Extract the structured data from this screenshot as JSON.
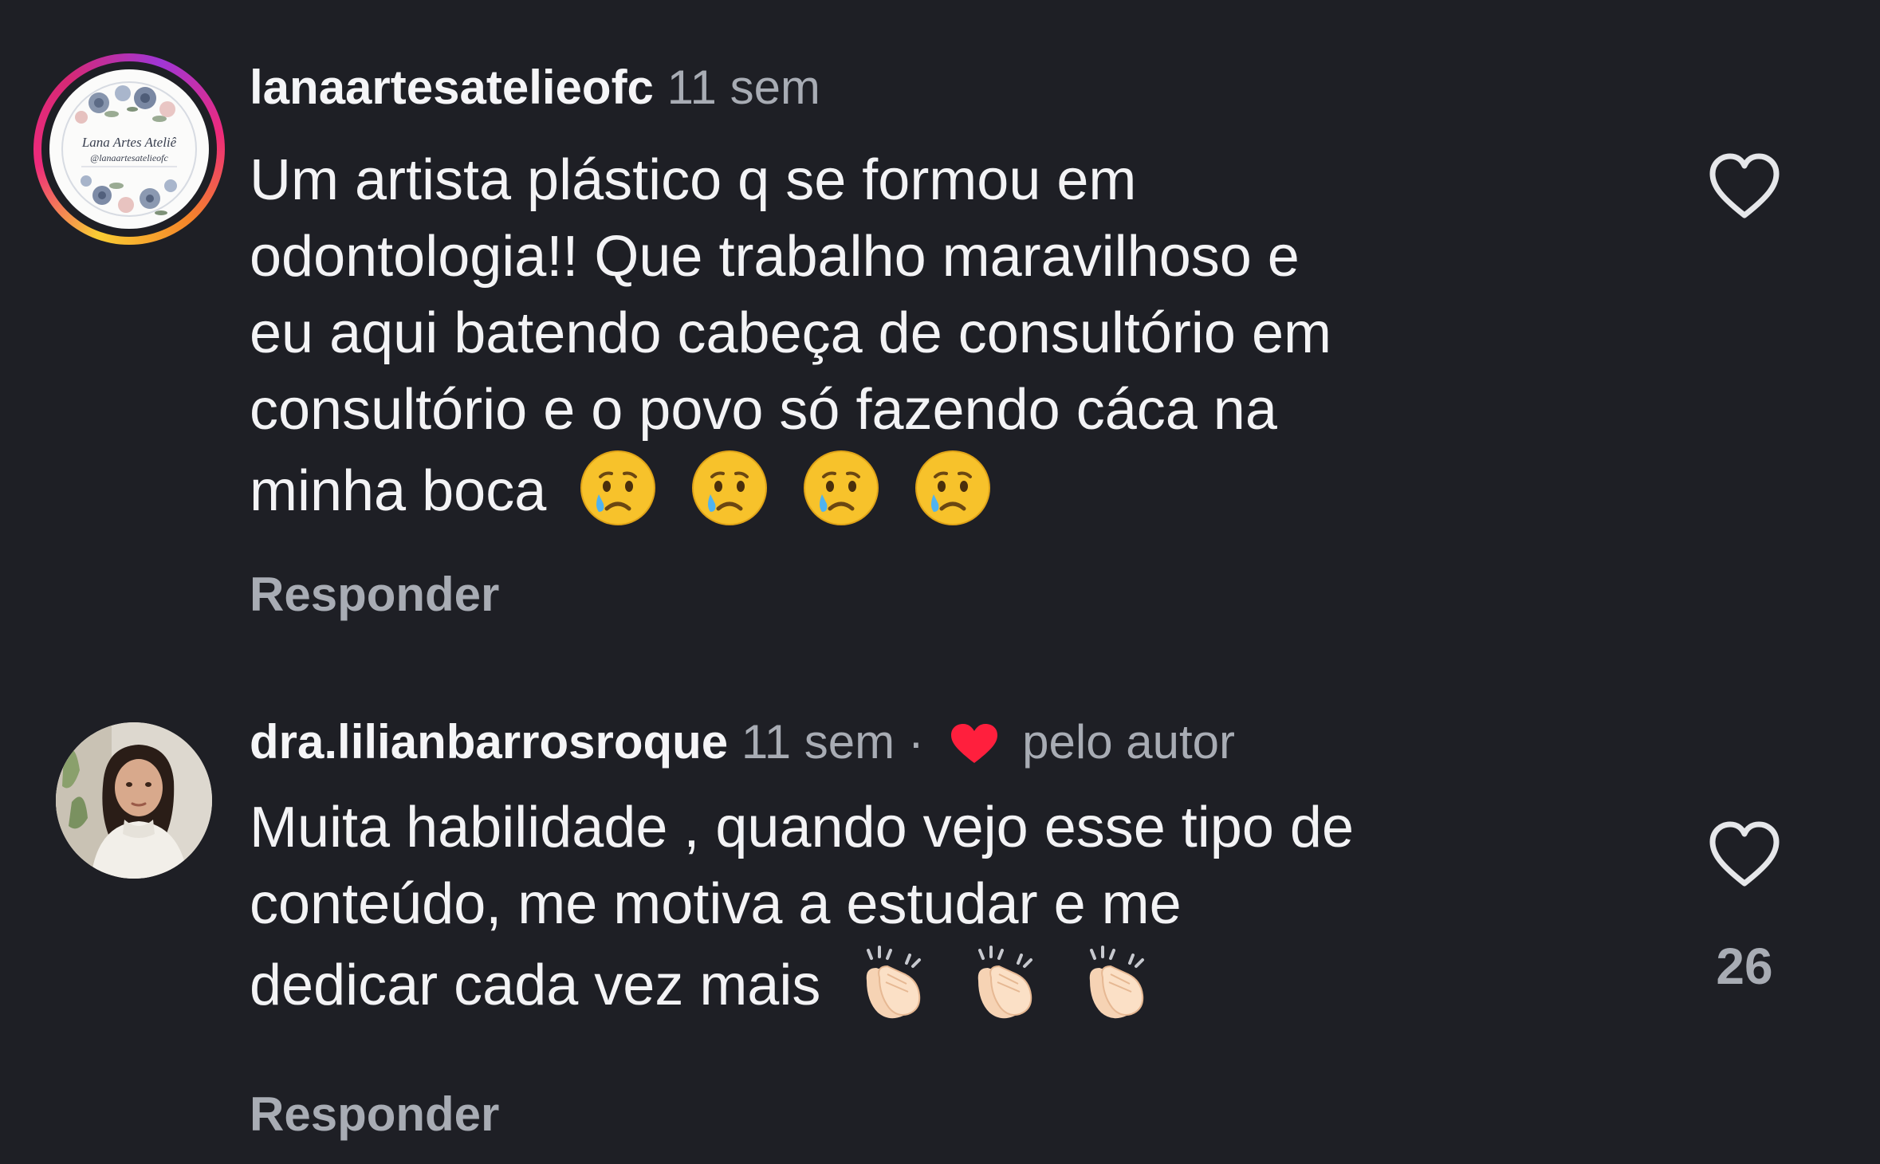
{
  "comments": [
    {
      "username": "lanaartesatelieofc",
      "time": "11 sem",
      "avatar": {
        "type": "logo",
        "title": "Lana Artes Ateliê",
        "handle": "@lanaartesatelieofc",
        "has_story_ring": true
      },
      "lines": [
        "Um artista plástico q se formou em",
        "odontologia!! Que trabalho maravilhoso e",
        "eu aqui batendo cabeça de consultório em",
        "consultório e o povo só fazendo cáca na",
        "minha boca"
      ],
      "emojis": [
        "crying-face",
        "crying-face",
        "crying-face",
        "crying-face"
      ],
      "reply_label": "Responder",
      "like_icon": "heart-outline-icon"
    },
    {
      "username": "dra.lilianbarrosroque",
      "time": "11 sem",
      "separator": "·",
      "liked_by_author_label": "pelo autor",
      "liked_by_author_icon": "heart-filled-icon",
      "avatar": {
        "type": "photo",
        "has_story_ring": false
      },
      "lines": [
        "Muita habilidade , quando vejo esse tipo de",
        "conteúdo, me motiva a estudar e me",
        "dedicar cada vez mais"
      ],
      "emojis": [
        "clapping-hands",
        "clapping-hands",
        "clapping-hands"
      ],
      "reply_label": "Responder",
      "like_icon": "heart-outline-icon",
      "like_count": "26"
    }
  ],
  "colors": {
    "background": "#1e1f25",
    "primary_text": "#f3f3f5",
    "secondary_text": "#a8acb4",
    "heart_red": "#ff1f3d",
    "ring_gradient": [
      "#f9ce34",
      "#ee2a7b",
      "#a036d6"
    ]
  }
}
